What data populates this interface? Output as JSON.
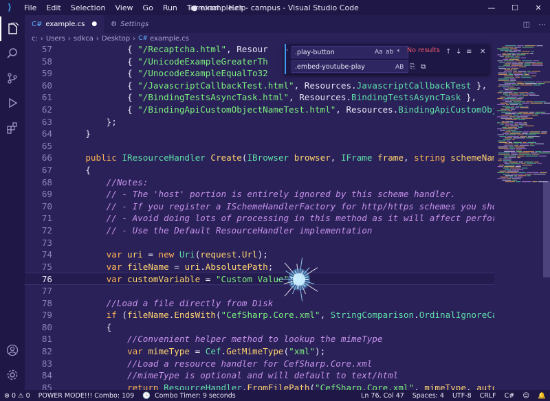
{
  "app": {
    "menu": [
      "File",
      "Edit",
      "Selection",
      "View",
      "Go",
      "Run",
      "Terminal",
      "Help"
    ],
    "title": "● example.cs - campus - Visual Studio Code",
    "window_controls": [
      "—",
      "☐",
      "✕"
    ]
  },
  "tabs": [
    {
      "label": "example.cs",
      "modified": "●"
    },
    {
      "label": "Settings"
    }
  ],
  "breadcrumb": [
    "c:",
    "Users",
    "sdkca",
    "Desktop",
    "example.cs"
  ],
  "find": {
    "search_value": ".play-button",
    "replace_value": ".embed-youtube-play",
    "options": [
      "Aa",
      "ab",
      "*",
      ""
    ],
    "result": "No results",
    "replace_opts": [
      "AB"
    ]
  },
  "editor": {
    "current_line": 76,
    "lines": [
      {
        "n": 57,
        "tokens": [
          [
            "pn",
            "            { "
          ],
          [
            "st",
            "\"/Recaptcha.html\""
          ],
          [
            "pn",
            ", Resour"
          ]
        ]
      },
      {
        "n": 58,
        "tokens": [
          [
            "pn",
            "            { "
          ],
          [
            "st",
            "\"/UnicodeExampleGreaterTh"
          ]
        ]
      },
      {
        "n": 59,
        "tokens": [
          [
            "pn",
            "            { "
          ],
          [
            "st",
            "\"/UnocodeExampleEqualTo32"
          ]
        ]
      },
      {
        "n": 60,
        "tokens": [
          [
            "pn",
            "            { "
          ],
          [
            "st",
            "\"/JavascriptCallbackTest.html\""
          ],
          [
            "pn",
            ", Resources."
          ],
          [
            "ty",
            "JavascriptCallbackTest"
          ],
          [
            "pn",
            " },"
          ]
        ]
      },
      {
        "n": 61,
        "tokens": [
          [
            "pn",
            "            { "
          ],
          [
            "st",
            "\"/BindingTestsAsyncTask.html\""
          ],
          [
            "pn",
            ", Resources."
          ],
          [
            "ty",
            "BindingTestsAsyncTask"
          ],
          [
            "pn",
            " },"
          ]
        ]
      },
      {
        "n": 62,
        "tokens": [
          [
            "pn",
            "            { "
          ],
          [
            "st",
            "\"/BindingApiCustomObjectNameTest.html\""
          ],
          [
            "pn",
            ", Resources."
          ],
          [
            "ty",
            "BindingApiCustomObj"
          ]
        ]
      },
      {
        "n": 63,
        "tokens": [
          [
            "pn",
            "        };"
          ]
        ]
      },
      {
        "n": 64,
        "tokens": [
          [
            "pn",
            "    }"
          ]
        ]
      },
      {
        "n": 65,
        "tokens": [
          [
            "pn",
            ""
          ]
        ]
      },
      {
        "n": 66,
        "tokens": [
          [
            "pn",
            "    "
          ],
          [
            "kw",
            "public"
          ],
          [
            "pn",
            " "
          ],
          [
            "ty",
            "IResourceHandler"
          ],
          [
            "pn",
            " "
          ],
          [
            "fn",
            "Create"
          ],
          [
            "pn",
            "("
          ],
          [
            "ty",
            "IBrowser"
          ],
          [
            "pn",
            " "
          ],
          [
            "fn",
            "browser"
          ],
          [
            "pn",
            ", "
          ],
          [
            "ty",
            "IFrame"
          ],
          [
            "pn",
            " "
          ],
          [
            "fn",
            "frame"
          ],
          [
            "pn",
            ", "
          ],
          [
            "kw",
            "string"
          ],
          [
            "pn",
            " "
          ],
          [
            "fn",
            "schemeNam"
          ]
        ]
      },
      {
        "n": 67,
        "tokens": [
          [
            "pn",
            "    {"
          ]
        ]
      },
      {
        "n": 68,
        "tokens": [
          [
            "pn",
            "        "
          ],
          [
            "cm",
            "//Notes:"
          ]
        ]
      },
      {
        "n": 69,
        "tokens": [
          [
            "pn",
            "        "
          ],
          [
            "cm",
            "// - The 'host' portion is entirely ignored by this scheme handler."
          ]
        ]
      },
      {
        "n": 70,
        "tokens": [
          [
            "pn",
            "        "
          ],
          [
            "cm",
            "// - If you register a ISchemeHandlerFactory for http/https schemes you sho"
          ]
        ]
      },
      {
        "n": 71,
        "tokens": [
          [
            "pn",
            "        "
          ],
          [
            "cm",
            "// - Avoid doing lots of processing in this method as it will affect perfor"
          ]
        ]
      },
      {
        "n": 72,
        "tokens": [
          [
            "pn",
            "        "
          ],
          [
            "cm",
            "// - Use the Default ResourceHandler implementation"
          ]
        ]
      },
      {
        "n": 73,
        "tokens": [
          [
            "pn",
            ""
          ]
        ]
      },
      {
        "n": 74,
        "tokens": [
          [
            "pn",
            "        "
          ],
          [
            "kw",
            "var"
          ],
          [
            "pn",
            " "
          ],
          [
            "fn",
            "uri"
          ],
          [
            "pn",
            " = "
          ],
          [
            "kw",
            "new"
          ],
          [
            "pn",
            " "
          ],
          [
            "ty",
            "Uri"
          ],
          [
            "pn",
            "("
          ],
          [
            "fn",
            "request"
          ],
          [
            "pn",
            "."
          ],
          [
            "fn",
            "Url"
          ],
          [
            "pn",
            ");"
          ]
        ]
      },
      {
        "n": 75,
        "tokens": [
          [
            "pn",
            "        "
          ],
          [
            "kw",
            "var"
          ],
          [
            "pn",
            " "
          ],
          [
            "fn",
            "fileName"
          ],
          [
            "pn",
            " = "
          ],
          [
            "fn",
            "uri"
          ],
          [
            "pn",
            "."
          ],
          [
            "fn",
            "AbsolutePath"
          ],
          [
            "pn",
            ";"
          ]
        ]
      },
      {
        "n": 76,
        "tokens": [
          [
            "pn",
            "        "
          ],
          [
            "kw",
            "var"
          ],
          [
            "pn",
            " "
          ],
          [
            "fn",
            "customVariable"
          ],
          [
            "pn",
            " = "
          ],
          [
            "st",
            "\"Custom Value\""
          ],
          [
            "pn",
            ";"
          ]
        ]
      },
      {
        "n": 77,
        "tokens": [
          [
            "pn",
            ""
          ]
        ]
      },
      {
        "n": 78,
        "tokens": [
          [
            "pn",
            "        "
          ],
          [
            "cm",
            "//Load a file directly from Disk"
          ]
        ]
      },
      {
        "n": 79,
        "tokens": [
          [
            "pn",
            "        "
          ],
          [
            "kw",
            "if"
          ],
          [
            "pn",
            " ("
          ],
          [
            "fn",
            "fileName"
          ],
          [
            "pn",
            "."
          ],
          [
            "fn",
            "EndsWith"
          ],
          [
            "pn",
            "("
          ],
          [
            "st",
            "\"CefSharp.Core.xml\""
          ],
          [
            "pn",
            ", "
          ],
          [
            "ty",
            "StringComparison"
          ],
          [
            "pn",
            "."
          ],
          [
            "ty",
            "OrdinalIgnoreCa"
          ]
        ]
      },
      {
        "n": 80,
        "tokens": [
          [
            "pn",
            "        {"
          ]
        ]
      },
      {
        "n": 81,
        "tokens": [
          [
            "pn",
            "            "
          ],
          [
            "cm",
            "//Convenient helper method to lookup the mimeType"
          ]
        ]
      },
      {
        "n": 82,
        "tokens": [
          [
            "pn",
            "            "
          ],
          [
            "kw",
            "var"
          ],
          [
            "pn",
            " "
          ],
          [
            "fn",
            "mimeType"
          ],
          [
            "pn",
            " = "
          ],
          [
            "ty",
            "Cef"
          ],
          [
            "pn",
            "."
          ],
          [
            "fn",
            "GetMimeType"
          ],
          [
            "pn",
            "("
          ],
          [
            "st",
            "\"xml\""
          ],
          [
            "pn",
            ");"
          ]
        ]
      },
      {
        "n": 83,
        "tokens": [
          [
            "pn",
            "            "
          ],
          [
            "cm",
            "//Load a resource handler for CefSharp.Core.xml"
          ]
        ]
      },
      {
        "n": 84,
        "tokens": [
          [
            "pn",
            "            "
          ],
          [
            "cm",
            "//mimeType is optional and will default to text/html"
          ]
        ]
      },
      {
        "n": 85,
        "tokens": [
          [
            "pn",
            "            "
          ],
          [
            "kw",
            "return"
          ],
          [
            "pn",
            " "
          ],
          [
            "ty",
            "ResourceHandler"
          ],
          [
            "pn",
            "."
          ],
          [
            "fn",
            "FromFilePath"
          ],
          [
            "pn",
            "("
          ],
          [
            "st",
            "\"CefSharp.Core.xml\""
          ],
          [
            "pn",
            ", "
          ],
          [
            "fn",
            "mimeType"
          ],
          [
            "pn",
            ", "
          ],
          [
            "fn",
            "auto"
          ]
        ]
      }
    ]
  },
  "status": {
    "errors": "0",
    "warnings": "0",
    "power_mode": "POWER MODE!!! Combo: 109",
    "combo_timer": "Combo Timer: 9 seconds",
    "position": "Ln 76, Col 47",
    "spaces": "Spaces: 4",
    "encoding": "UTF-8",
    "eol": "CRLF",
    "language": "C#"
  },
  "colors": {
    "accent": "#3b9cf0",
    "background": "#2a2159",
    "error": "#f0586a"
  }
}
